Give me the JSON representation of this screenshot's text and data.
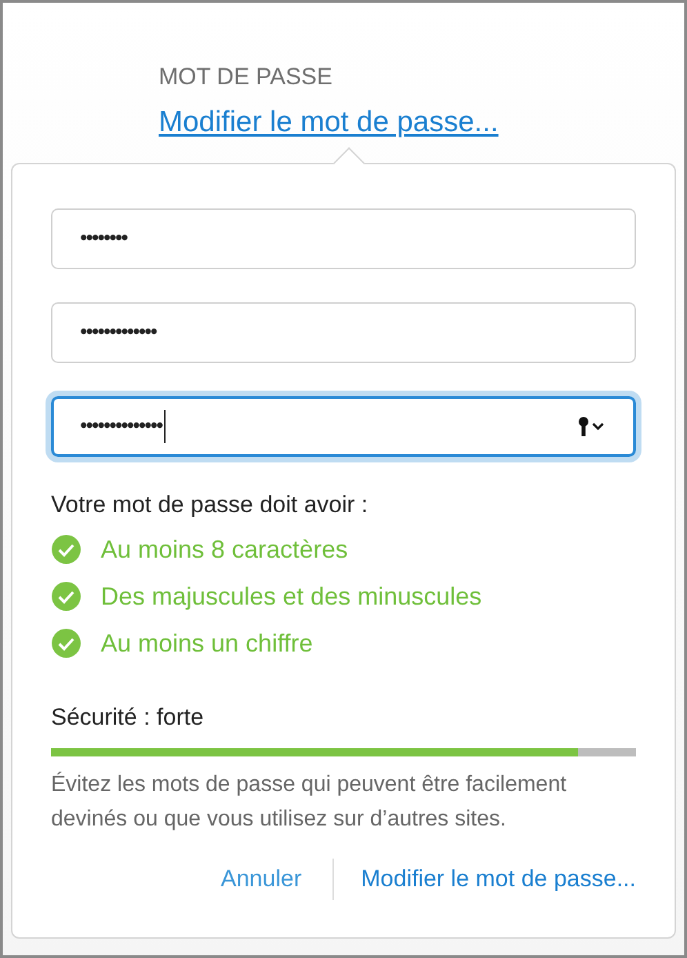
{
  "section": {
    "heading": "MOT DE PASSE",
    "link": "Modifier le mot de passe..."
  },
  "fields": [
    {
      "value": "••••••••",
      "focused": false
    },
    {
      "value": "•••••••••••••",
      "focused": false
    },
    {
      "value": "••••••••••••••",
      "focused": true
    }
  ],
  "requirements": {
    "title": "Votre mot de passe doit avoir :",
    "items": [
      {
        "label": "Au moins 8 caractères",
        "met": true
      },
      {
        "label": "Des majuscules et des minuscules",
        "met": true
      },
      {
        "label": "Au moins un chiffre",
        "met": true
      }
    ]
  },
  "strength": {
    "label": "Sécurité : forte",
    "level": 0.9
  },
  "hint": "Évitez les mots de passe qui peuvent être facilement devinés ou que vous utilisez sur d’autres sites.",
  "buttons": [
    "Annuler",
    "Modifier le mot de passe..."
  ]
}
